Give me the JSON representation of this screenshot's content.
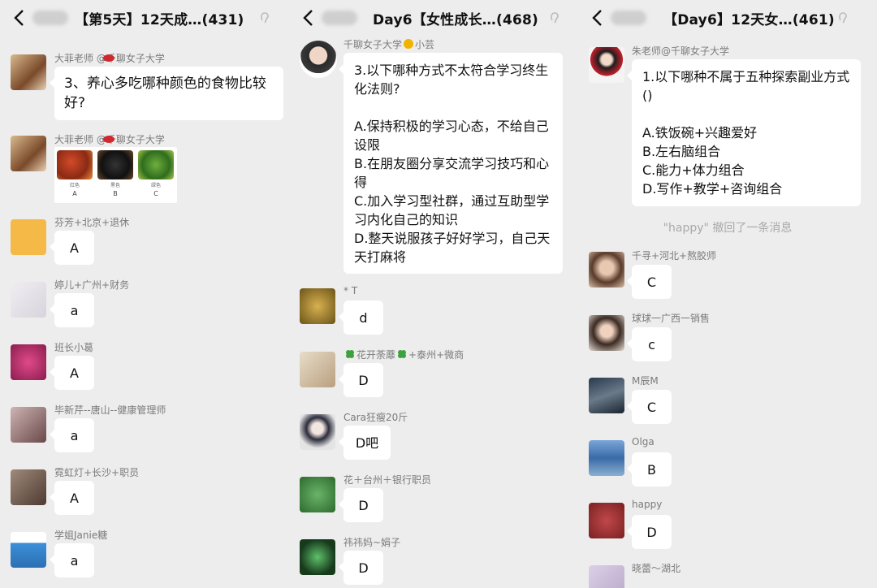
{
  "panels": [
    {
      "title": "【第5天】12天成…(431)",
      "question": {
        "sender": "大菲老师 @千聊女子大学",
        "sender_icon": "lips-icon",
        "text": "3、养心多吃哪种颜色的食物比较好?"
      },
      "image_message": {
        "sender": "大菲老师 @千聊女子大学",
        "sender_icon": "lips-icon",
        "labels": [
          "A",
          "B",
          "C"
        ],
        "sublabels": [
          "红色",
          "黑色",
          "绿色"
        ]
      },
      "replies": [
        {
          "sender": "芬芳+北京+退休",
          "text": "A"
        },
        {
          "sender": "婷儿+广州+财务",
          "text": "a"
        },
        {
          "sender": "班长小葛",
          "text": "A"
        },
        {
          "sender": "毕新芹--唐山--健康管理师",
          "text": "a"
        },
        {
          "sender": "霓虹灯+长沙+职员",
          "text": "A"
        },
        {
          "sender": "学姐Janie糖",
          "text": "a"
        }
      ]
    },
    {
      "title": "Day6【女性成长…(468)",
      "question": {
        "sender_pre": "千聊女子大学",
        "sender_icon": "sun-icon",
        "sender_post": "小芸",
        "text": "3.以下哪种方式不太符合学习终生化法则?\n\nA.保持积极的学习心态，不给自己设限\nB.在朋友圈分享交流学习技巧和心得\nC.加入学习型社群，通过互助型学习内化自己的知识\nD.整天说服孩子好好学习，自己天天打麻将"
      },
      "replies": [
        {
          "sender": "* T",
          "text": "d"
        },
        {
          "sender_pre": "",
          "sender_mid": "花开荼蘼",
          "sender_post": "+泰州+微商",
          "sender_icon": "clover-icon",
          "text": "D"
        },
        {
          "sender": "Cara狂瘦20斤",
          "text": "D吧"
        },
        {
          "sender": "花＋台州＋银行职员",
          "text": "D"
        },
        {
          "sender": "祎祎妈~娟子",
          "text": "D"
        }
      ]
    },
    {
      "title": "【Day6】12天女…(461)",
      "question": {
        "sender": "朱老师@千聊女子大学",
        "text": "1.以下哪种不属于五种探索副业方式()\n\nA.铁饭碗+兴趣爱好\nB.左右脑组合\nC.能力+体力组合\nD.写作+教学+咨询组合"
      },
      "system_note": "\"happy\" 撤回了一条消息",
      "replies": [
        {
          "sender": "千寻+河北+熬胶师",
          "text": "C"
        },
        {
          "sender": "球球一广西一销售",
          "text": "c"
        },
        {
          "sender": "M辰M",
          "text": "C"
        },
        {
          "sender": "Olga",
          "text": "B"
        },
        {
          "sender": "happy",
          "text": "D"
        },
        {
          "sender": "晓蕾～湖北",
          "text": ""
        }
      ]
    }
  ]
}
